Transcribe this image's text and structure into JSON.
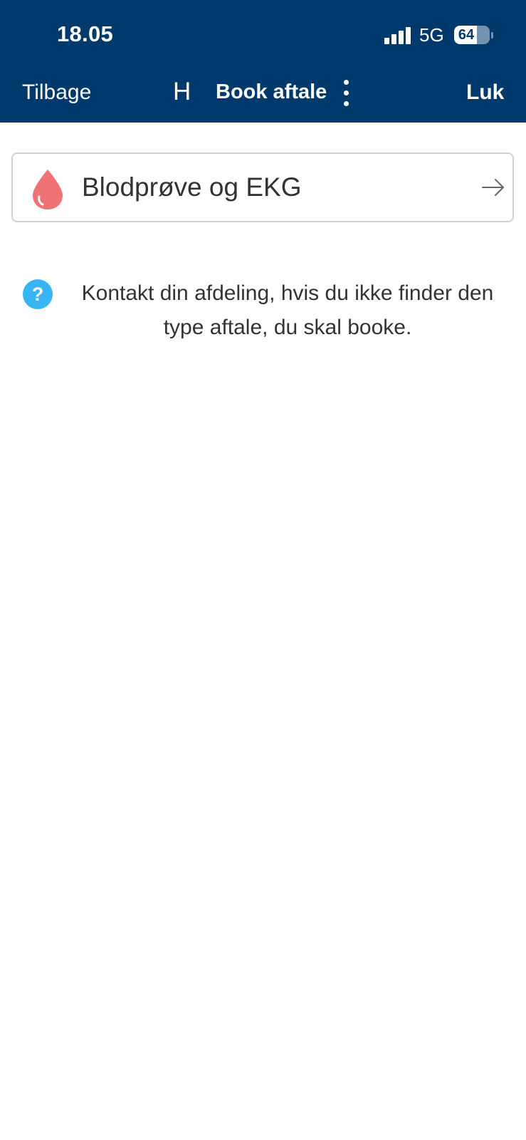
{
  "status_bar": {
    "time": "18.05",
    "network": "5G",
    "battery_level": "64"
  },
  "nav": {
    "back_label": "Tilbage",
    "logo_text": "H",
    "title": "Book aftale",
    "close_label": "Luk"
  },
  "appointment_types": [
    {
      "label": "Blodprøve og EKG",
      "icon": "blood-drop-icon",
      "icon_color": "#f07272"
    }
  ],
  "info": {
    "icon": "question-icon",
    "icon_color": "#38b5f5",
    "text": "Kontakt din afdeling, hvis du ikke finder den type aftale, du skal booke."
  },
  "colors": {
    "header_bg": "#00396b",
    "text": "#333333"
  }
}
